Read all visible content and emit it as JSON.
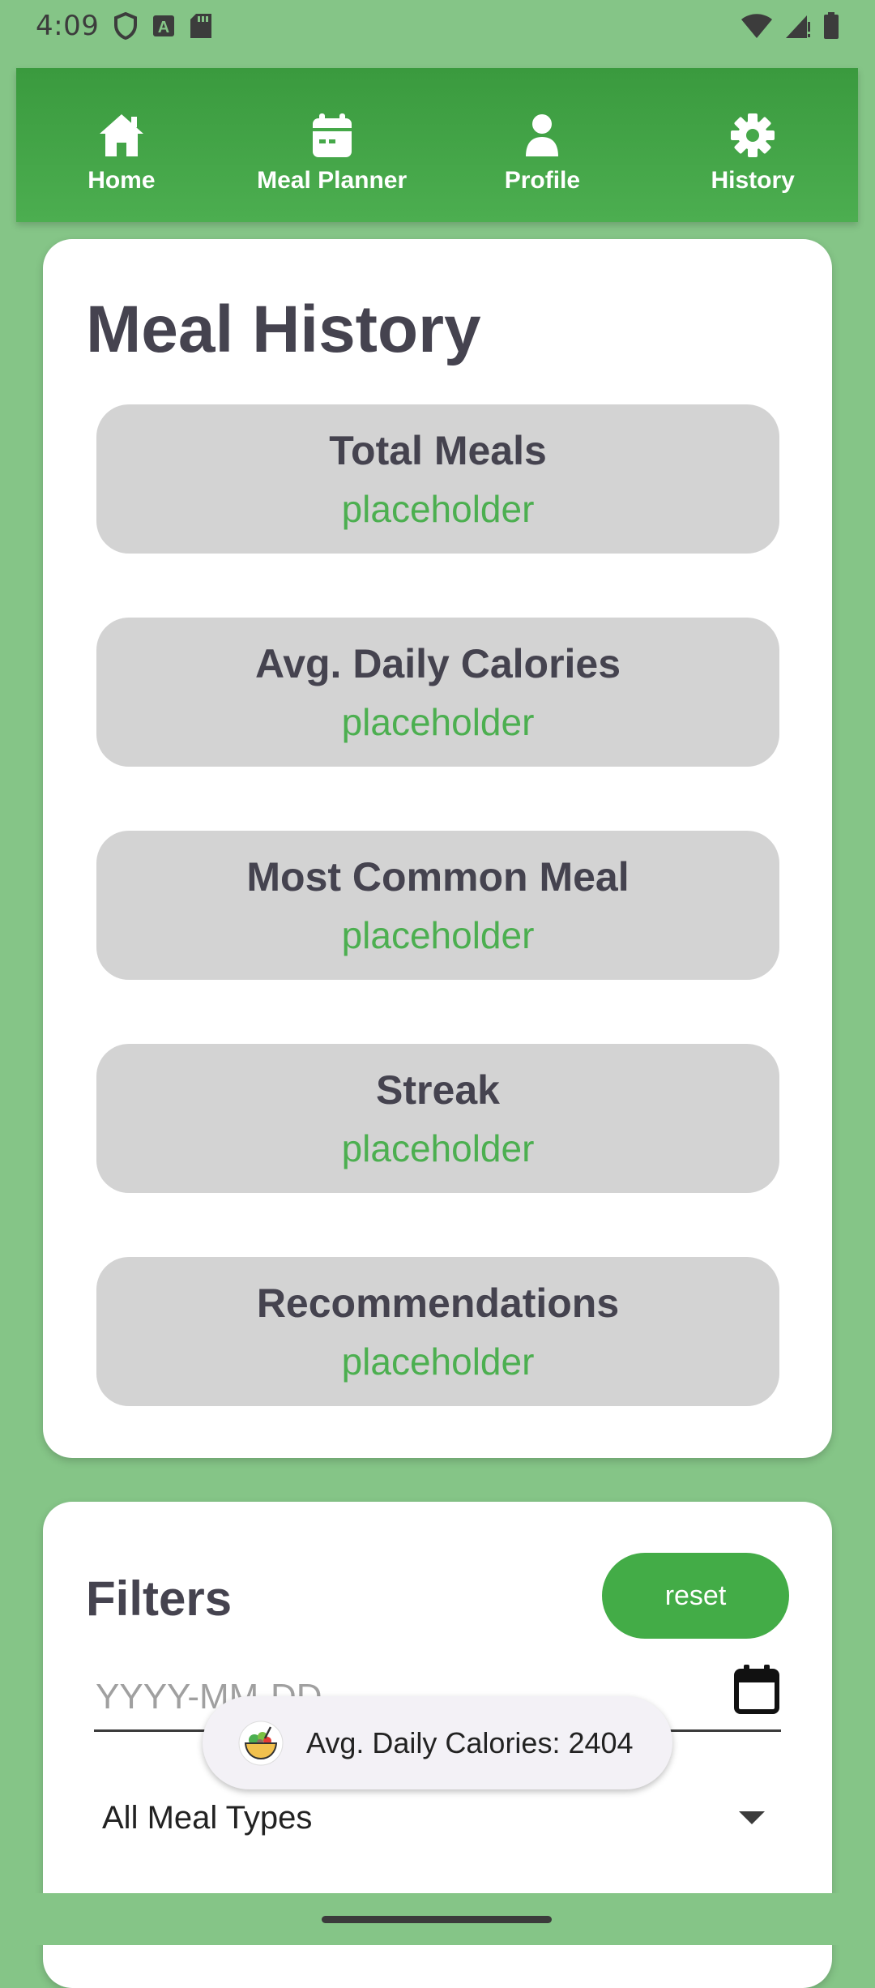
{
  "status": {
    "time": "4:09"
  },
  "nav": {
    "items": [
      {
        "label": "Home",
        "icon": "home-icon"
      },
      {
        "label": "Meal Planner",
        "icon": "calendar-icon"
      },
      {
        "label": "Profile",
        "icon": "person-icon"
      },
      {
        "label": "History",
        "icon": "gear-icon"
      }
    ]
  },
  "history": {
    "title": "Meal History",
    "stats": [
      {
        "title": "Total Meals",
        "value": "placeholder"
      },
      {
        "title": "Avg. Daily Calories",
        "value": "placeholder"
      },
      {
        "title": "Most Common Meal",
        "value": "placeholder"
      },
      {
        "title": "Streak",
        "value": "placeholder"
      },
      {
        "title": "Recommendations",
        "value": "placeholder"
      }
    ]
  },
  "filters": {
    "title": "Filters",
    "reset_label": "reset",
    "date_placeholder": "YYYY-MM-DD",
    "meal_type_selected": "All Meal Types"
  },
  "toast": {
    "text": "Avg. Daily Calories: 2404"
  },
  "colors": {
    "accent": "#4caf50",
    "background": "#85c587",
    "nav": "#3a9a3e"
  }
}
